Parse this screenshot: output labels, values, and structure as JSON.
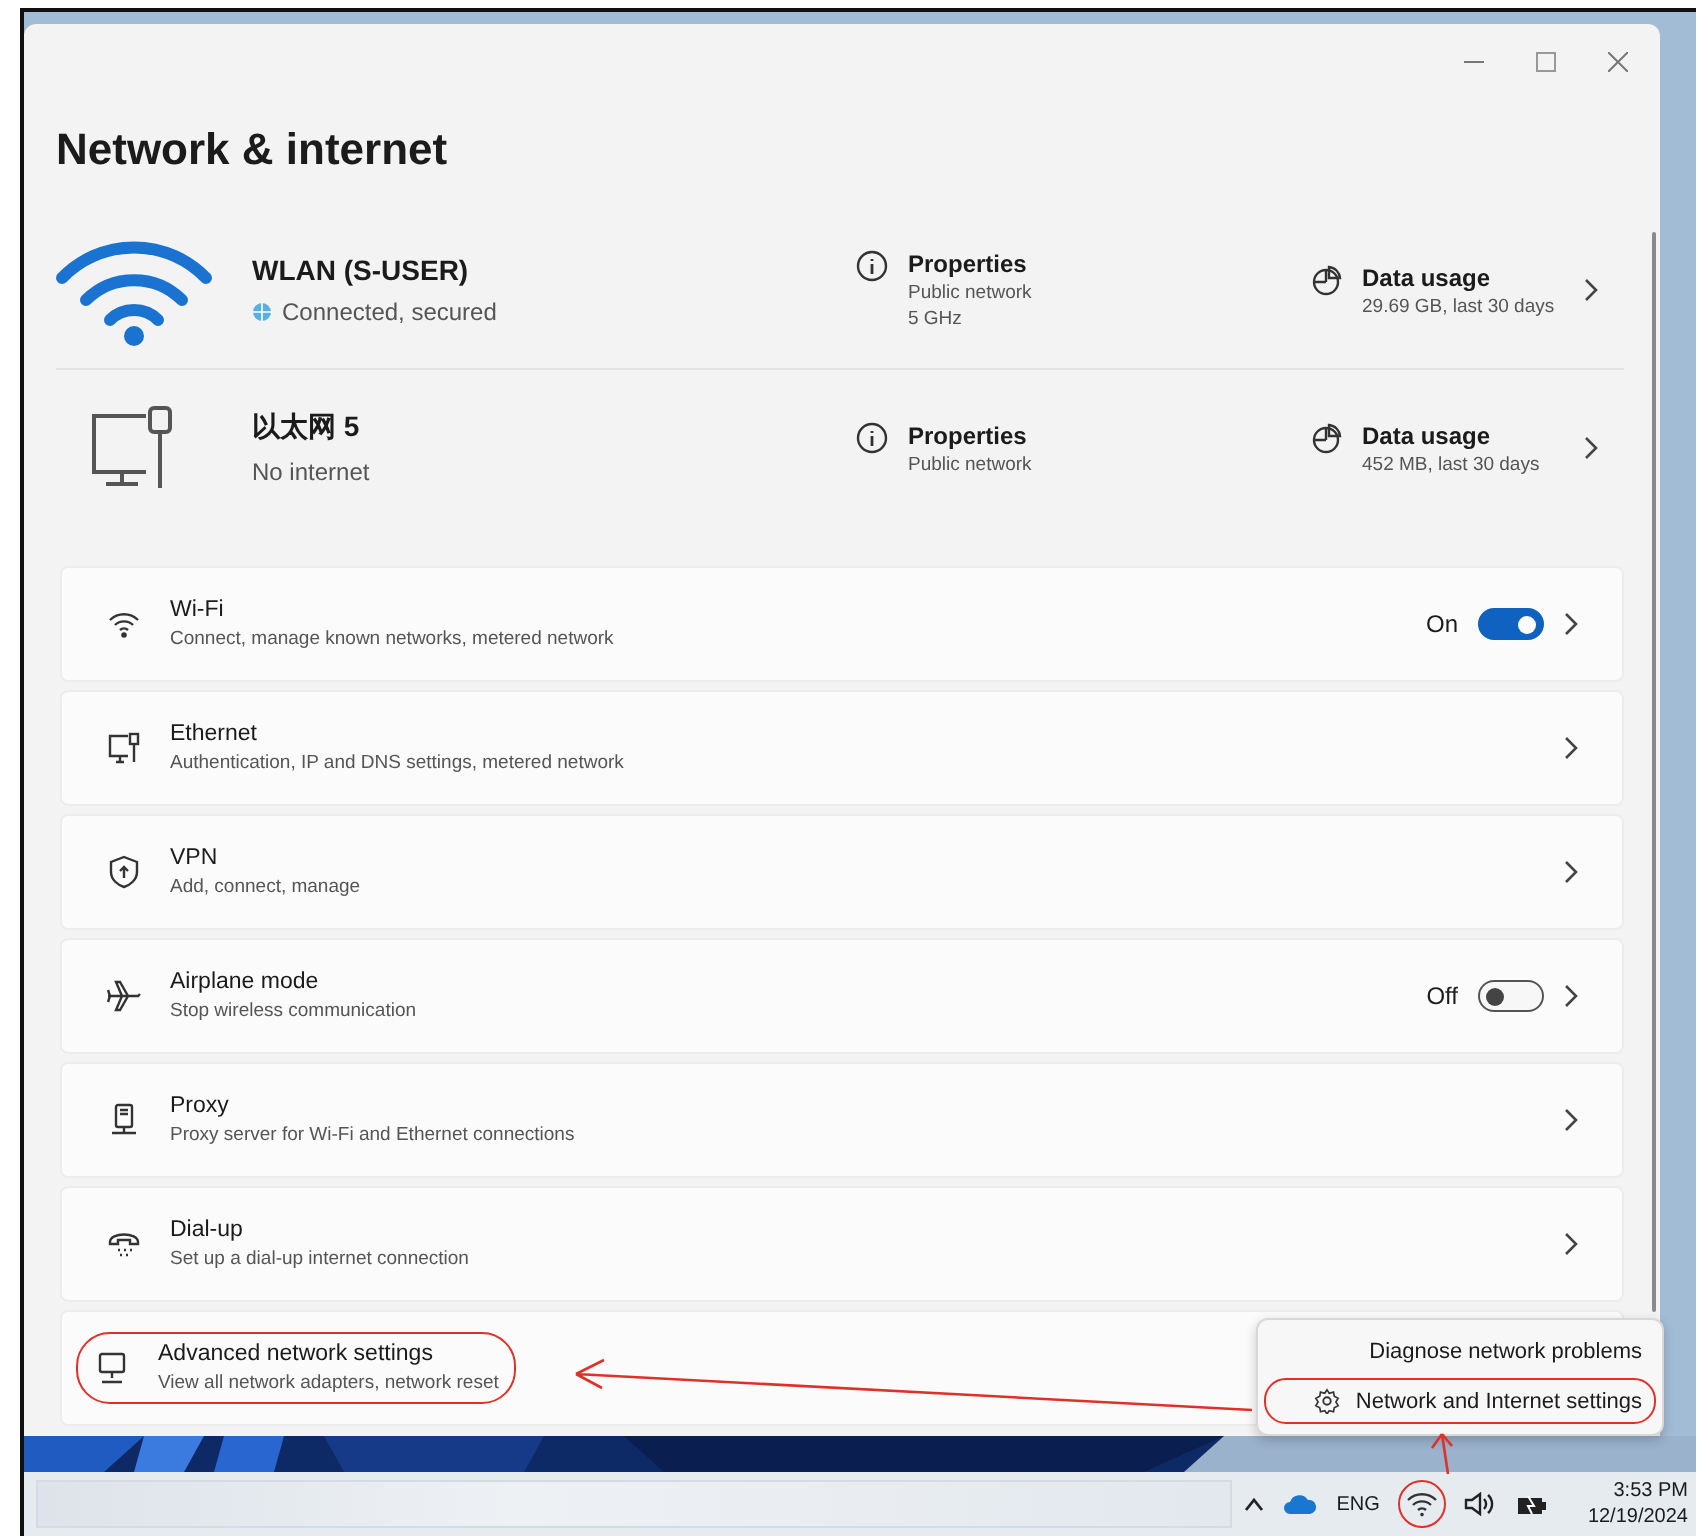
{
  "window": {
    "title": "Network & internet"
  },
  "connections": [
    {
      "kind": "wifi",
      "name": "WLAN (S-USER)",
      "status": "Connected, secured",
      "properties": {
        "title": "Properties",
        "lines": [
          "Public network",
          "5 GHz"
        ]
      },
      "data_usage": {
        "title": "Data usage",
        "detail": "29.69 GB, last 30 days"
      }
    },
    {
      "kind": "ethernet",
      "name": "以太网 5",
      "status": "No internet",
      "properties": {
        "title": "Properties",
        "lines": [
          "Public network"
        ]
      },
      "data_usage": {
        "title": "Data usage",
        "detail": "452 MB, last 30 days"
      }
    }
  ],
  "settings": [
    {
      "title": "Wi-Fi",
      "subtitle": "Connect, manage known networks, metered network",
      "kind": "toggle",
      "toggle_label": "On",
      "on": true,
      "annotated": false
    },
    {
      "title": "Ethernet",
      "subtitle": "Authentication, IP and DNS settings, metered network",
      "kind": "link",
      "annotated": false
    },
    {
      "title": "VPN",
      "subtitle": "Add, connect, manage",
      "kind": "link",
      "annotated": false
    },
    {
      "title": "Airplane mode",
      "subtitle": "Stop wireless communication",
      "kind": "toggle",
      "toggle_label": "Off",
      "on": false,
      "annotated": false
    },
    {
      "title": "Proxy",
      "subtitle": "Proxy server for Wi-Fi and Ethernet connections",
      "kind": "link",
      "annotated": false
    },
    {
      "title": "Dial-up",
      "subtitle": "Set up a dial-up internet connection",
      "kind": "link",
      "annotated": false
    },
    {
      "title": "Advanced network settings",
      "subtitle": "View all network adapters, network reset",
      "kind": "link",
      "annotated": true
    }
  ],
  "context_menu": [
    {
      "label": "Diagnose network problems",
      "annotated": false
    },
    {
      "label": "Network and Internet settings",
      "annotated": true
    }
  ],
  "taskbar": {
    "language": "ENG",
    "time": "3:53 PM",
    "date": "12/19/2024",
    "wifi_annotated": true
  }
}
